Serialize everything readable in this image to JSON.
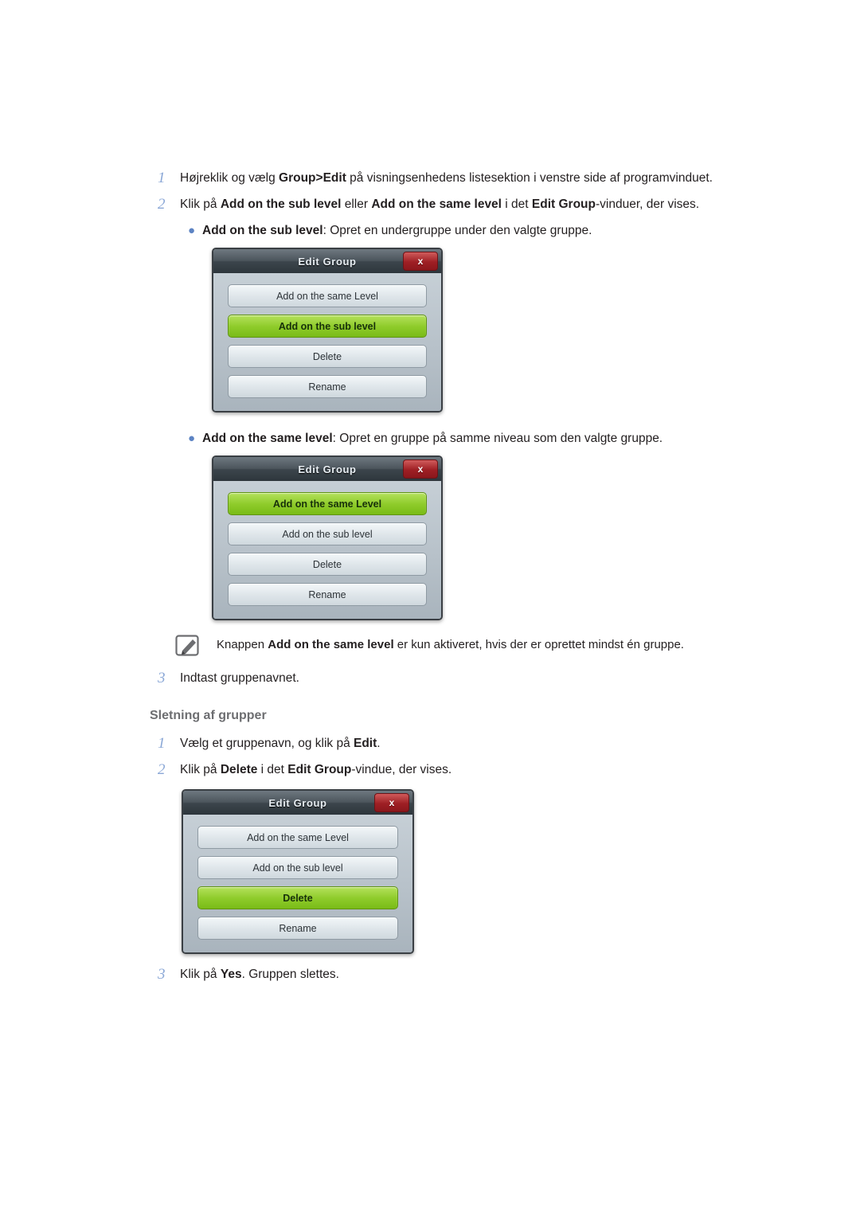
{
  "steps_group_edit": [
    {
      "num": "1",
      "segments": [
        {
          "t": "Højreklik og vælg ",
          "b": false
        },
        {
          "t": "Group>Edit",
          "b": true
        },
        {
          "t": " på visningsenhedens listesektion i venstre side af programvinduet.",
          "b": false
        }
      ]
    },
    {
      "num": "2",
      "segments": [
        {
          "t": "Klik på ",
          "b": false
        },
        {
          "t": "Add on the sub level",
          "b": true
        },
        {
          "t": " eller ",
          "b": false
        },
        {
          "t": "Add on the same level",
          "b": true
        },
        {
          "t": " i det ",
          "b": false
        },
        {
          "t": "Edit Group",
          "b": true
        },
        {
          "t": "-vinduer, der vises.",
          "b": false
        }
      ]
    }
  ],
  "bullet_sub": {
    "dot": "●",
    "segments": [
      {
        "t": "Add on the sub level",
        "b": true
      },
      {
        "t": ": Opret en undergruppe under den valgte gruppe.",
        "b": false
      }
    ]
  },
  "bullet_same": {
    "dot": "●",
    "segments": [
      {
        "t": "Add on the same level",
        "b": true
      },
      {
        "t": ": Opret en gruppe på samme niveau som den valgte gruppe.",
        "b": false
      }
    ]
  },
  "dialog": {
    "title": "Edit Group",
    "close_label": "x",
    "buttons": [
      {
        "label": "Add on the same Level"
      },
      {
        "label": "Add on the sub level"
      },
      {
        "label": "Delete"
      },
      {
        "label": "Rename"
      }
    ],
    "active_index_1": 1,
    "active_index_2": 0,
    "active_index_3": 2
  },
  "note": {
    "segments": [
      {
        "t": "Knappen ",
        "b": false
      },
      {
        "t": "Add on the same level",
        "b": true
      },
      {
        "t": " er kun aktiveret, hvis der er oprettet mindst én gruppe.",
        "b": false
      }
    ]
  },
  "step3_add": {
    "num": "3",
    "segments": [
      {
        "t": "Indtast gruppenavnet.",
        "b": false
      }
    ]
  },
  "section_delete": {
    "heading": "Sletning af grupper",
    "steps": [
      {
        "num": "1",
        "segments": [
          {
            "t": "Vælg et gruppenavn, og klik på ",
            "b": false
          },
          {
            "t": "Edit",
            "b": true
          },
          {
            "t": ".",
            "b": false
          }
        ]
      },
      {
        "num": "2",
        "segments": [
          {
            "t": "Klik på ",
            "b": false
          },
          {
            "t": "Delete",
            "b": true
          },
          {
            "t": " i det ",
            "b": false
          },
          {
            "t": "Edit Group",
            "b": true
          },
          {
            "t": "-vindue, der vises.",
            "b": false
          }
        ]
      }
    ],
    "step3": {
      "num": "3",
      "segments": [
        {
          "t": "Klik på ",
          "b": false
        },
        {
          "t": "Yes",
          "b": true
        },
        {
          "t": ". Gruppen slettes.",
          "b": false
        }
      ]
    }
  },
  "colors": {
    "step_number": "#8aa7d6",
    "heading": "#6d6e71",
    "active_button": "#8fcc2b",
    "close_button": "#9e1f24"
  }
}
